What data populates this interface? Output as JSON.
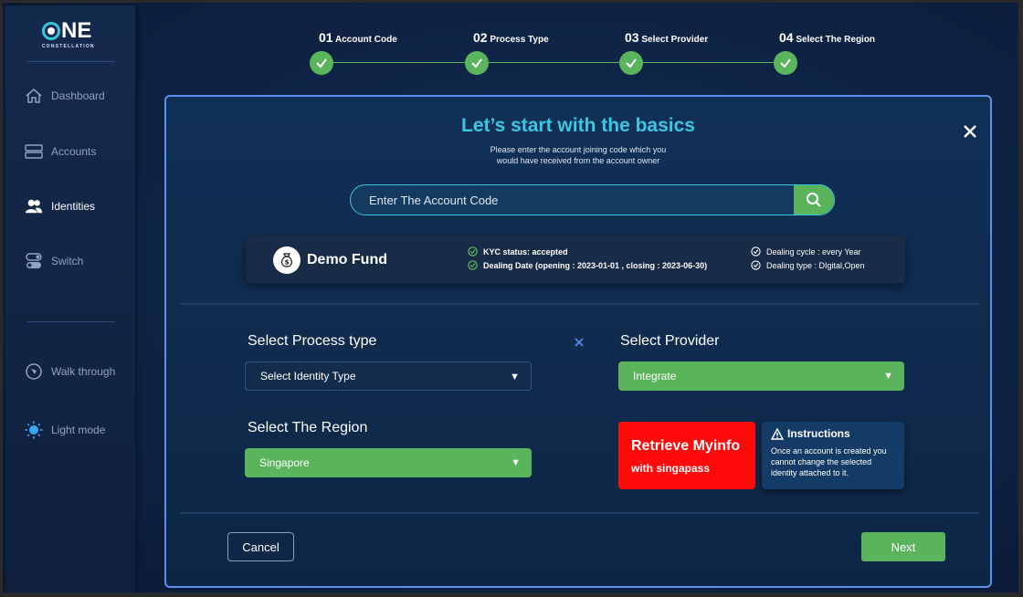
{
  "brand": {
    "name": "NE",
    "tagline": "CONSTELLATION"
  },
  "sidebar": {
    "items": [
      {
        "label": "Dashboard",
        "icon": "home-icon"
      },
      {
        "label": "Accounts",
        "icon": "server-icon"
      },
      {
        "label": "Identities",
        "icon": "users-icon"
      },
      {
        "label": "Switch",
        "icon": "toggle-icon"
      },
      {
        "label": "Walk through",
        "icon": "compass-icon"
      },
      {
        "label": "Light mode",
        "icon": "sun-icon"
      }
    ],
    "active": "Identities"
  },
  "stepper": {
    "steps": [
      {
        "num": "01",
        "label": "Account Code"
      },
      {
        "num": "02",
        "label": "Process Type"
      },
      {
        "num": "03",
        "label": "Select Provider"
      },
      {
        "num": "04",
        "label": "Select The Region"
      }
    ],
    "color": "#5ab45c"
  },
  "modal": {
    "title": "Let’s start with the basics",
    "subtitle_line1": "Please enter the account joining code which you",
    "subtitle_line2": "would have received from the account owner",
    "search_placeholder": "Enter The Account Code",
    "fund": {
      "name": "Demo Fund",
      "kyc_label": "KYC status: accepted",
      "dealing_date": "Dealing Date (opening : 2023-01-01 , closing : 2023-06-30)",
      "dealing_cycle": "Dealing cycle : every Year",
      "dealing_type": "Dealing type : DIgital,Open"
    },
    "process_type": {
      "label": "Select Process type",
      "value": "Select Identity Type"
    },
    "provider": {
      "label": "Select Provider",
      "value": "Integrate"
    },
    "region": {
      "label": "Select The Region",
      "value": "Singapore"
    },
    "myinfo": {
      "title": "Retrieve Myinfo",
      "subtitle": "with singapass"
    },
    "instructions": {
      "title": "Instructions",
      "body": "Once an account is created you cannot change the selected identity attached to it."
    },
    "cancel_label": "Cancel",
    "next_label": "Next"
  },
  "colors": {
    "accent": "#39c7e4",
    "green": "#5ab45c",
    "red": "#ff0a0a",
    "border": "#5f8fe8"
  }
}
